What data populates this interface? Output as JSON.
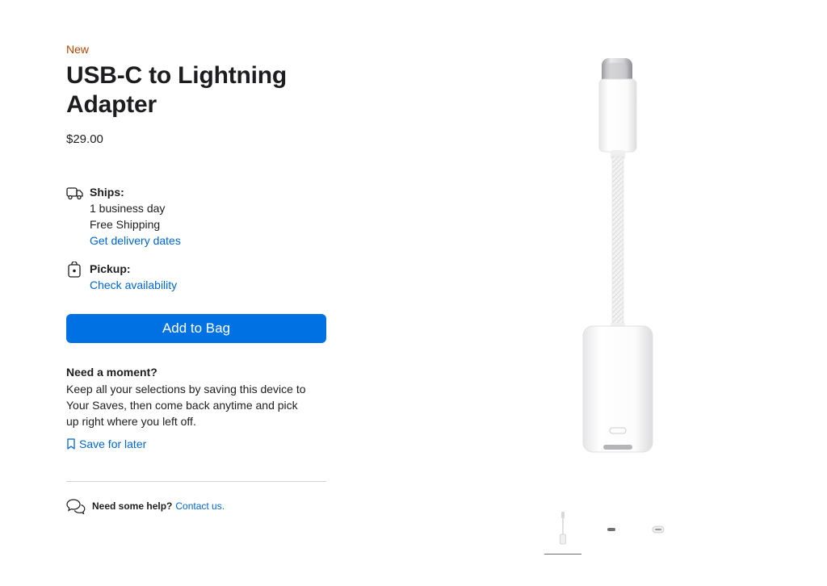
{
  "product": {
    "badge": "New",
    "title_line1": "USB-C to Lightning",
    "title_line2": "Adapter",
    "price": "$29.00"
  },
  "delivery": {
    "ships_label": "Ships:",
    "ships_time": "1 business day",
    "ships_cost": "Free Shipping",
    "delivery_link": "Get delivery dates",
    "pickup_label": "Pickup:",
    "pickup_link": "Check availability"
  },
  "actions": {
    "add_to_bag": "Add to Bag"
  },
  "save": {
    "heading": "Need a moment?",
    "body": "Keep all your selections by saving this device to Your Saves, then come back anytime and pick up right where you left off.",
    "link": "Save for later"
  },
  "help": {
    "question": "Need some help?",
    "link": "Contact us."
  },
  "gallery": {
    "selected_index": 0,
    "thumbnail_count": 3
  },
  "colors": {
    "accent": "#0071e3",
    "link": "#0066cc",
    "new_badge": "#b64400",
    "text": "#1d1d1f"
  },
  "icons": [
    "truck-icon",
    "shopping-bag-icon",
    "bookmark-icon",
    "chat-bubbles-icon"
  ]
}
